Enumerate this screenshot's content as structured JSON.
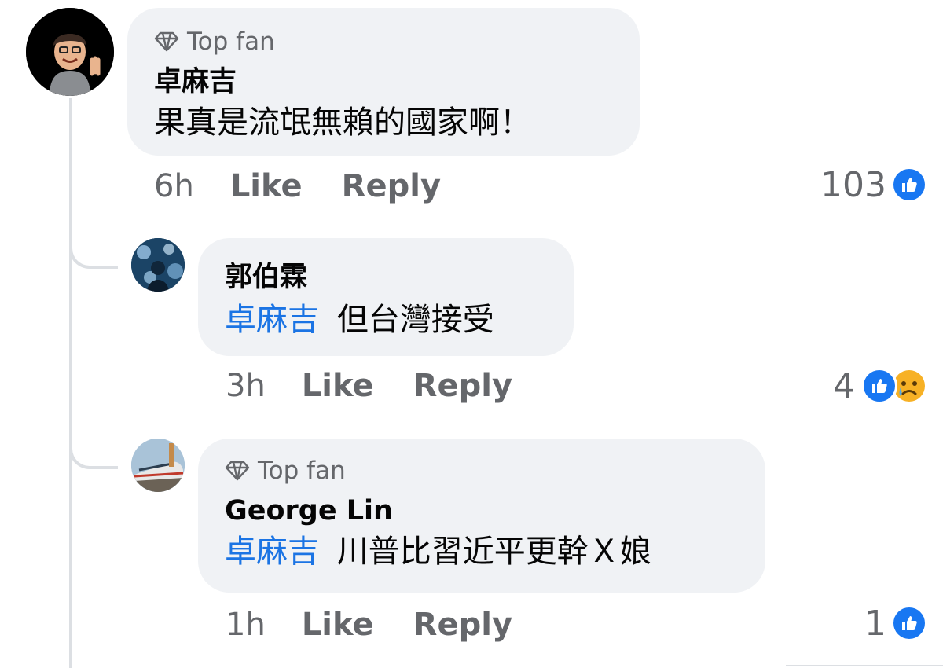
{
  "comments": [
    {
      "badge": "Top fan",
      "author": "卓麻吉",
      "mention": "",
      "text": "果真是流氓無賴的國家啊！",
      "time": "6h",
      "like_label": "Like",
      "reply_label": "Reply",
      "reaction_count": "103",
      "reactions": [
        "like-icon"
      ]
    },
    {
      "badge": "",
      "author": "郭伯霖",
      "mention": "卓麻吉",
      "text": "但台灣接受",
      "time": "3h",
      "like_label": "Like",
      "reply_label": "Reply",
      "reaction_count": "4",
      "reactions": [
        "like-icon",
        "sad-face-icon"
      ]
    },
    {
      "badge": "Top fan",
      "author": "George Lin",
      "mention": "卓麻吉",
      "text": "川普比習近平更幹Ｘ娘",
      "time": "1h",
      "like_label": "Like",
      "reply_label": "Reply",
      "reaction_count": "1",
      "reactions": [
        "like-icon"
      ]
    }
  ],
  "colors": {
    "bubble": "#f0f2f5",
    "mention": "#1b74e4",
    "secondary_text": "#65676b",
    "like_blue": "#1877f2",
    "thread_line": "#dcdfe3"
  }
}
